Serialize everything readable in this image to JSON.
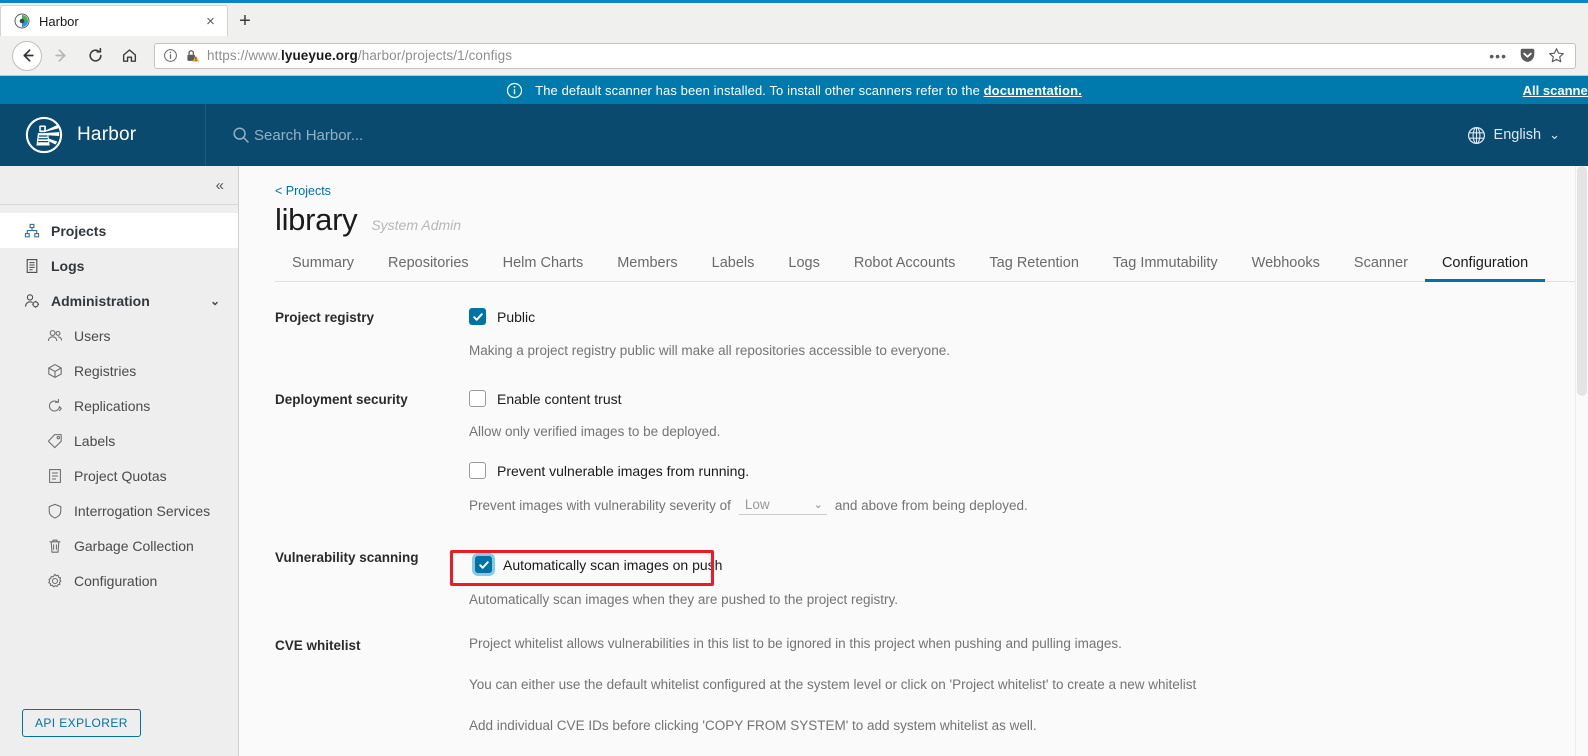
{
  "browser": {
    "tab": {
      "title": "Harbor",
      "favicon": "harbor-favicon",
      "close_label": "×"
    },
    "new_tab_label": "+",
    "nav": {
      "back": "←",
      "forward": "→",
      "reload": "⟳",
      "home": "⌂"
    },
    "url": {
      "scheme": "https://www.",
      "domain": "lyueyue.org",
      "path": "/harbor/projects/1/configs",
      "info_icon": "info-circle-icon",
      "lock_icon": "lock-warning-icon"
    },
    "url_actions": {
      "more": "•••",
      "pocket": "pocket-icon",
      "bookmark": "star-icon"
    }
  },
  "banner": {
    "icon": "info-circle-icon",
    "text_before": "The default scanner has been installed. To install other scanners refer to the ",
    "link": "documentation.",
    "right_link": "All scanners"
  },
  "header": {
    "brand": "Harbor",
    "logo": "harbor-lighthouse-logo",
    "search_placeholder": "Search Harbor...",
    "search_icon": "search-icon",
    "language": "English",
    "language_icon": "globe-icon",
    "language_chevron": "⌄"
  },
  "sidebar": {
    "collapse_icon": "«",
    "items": [
      {
        "label": "Projects",
        "icon": "projects-icon",
        "active": true,
        "sub": false
      },
      {
        "label": "Logs",
        "icon": "logs-icon",
        "active": false,
        "sub": false
      },
      {
        "label": "Administration",
        "icon": "administration-icon",
        "active": false,
        "sub": false,
        "chevron": "⌄"
      },
      {
        "label": "Users",
        "icon": "users-icon",
        "active": false,
        "sub": true
      },
      {
        "label": "Registries",
        "icon": "registries-icon",
        "active": false,
        "sub": true
      },
      {
        "label": "Replications",
        "icon": "replications-icon",
        "active": false,
        "sub": true
      },
      {
        "label": "Labels",
        "icon": "labels-icon",
        "active": false,
        "sub": true
      },
      {
        "label": "Project Quotas",
        "icon": "project-quotas-icon",
        "active": false,
        "sub": true
      },
      {
        "label": "Interrogation Services",
        "icon": "interrogation-services-icon",
        "active": false,
        "sub": true
      },
      {
        "label": "Garbage Collection",
        "icon": "garbage-collection-icon",
        "active": false,
        "sub": true
      },
      {
        "label": "Configuration",
        "icon": "configuration-icon",
        "active": false,
        "sub": true
      }
    ],
    "api_explorer": "API EXPLORER"
  },
  "main": {
    "breadcrumb": "< Projects",
    "project_name": "library",
    "project_role": "System Admin",
    "tabs": [
      {
        "label": "Summary",
        "active": false
      },
      {
        "label": "Repositories",
        "active": false
      },
      {
        "label": "Helm Charts",
        "active": false
      },
      {
        "label": "Members",
        "active": false
      },
      {
        "label": "Labels",
        "active": false
      },
      {
        "label": "Logs",
        "active": false
      },
      {
        "label": "Robot Accounts",
        "active": false
      },
      {
        "label": "Tag Retention",
        "active": false
      },
      {
        "label": "Tag Immutability",
        "active": false
      },
      {
        "label": "Webhooks",
        "active": false
      },
      {
        "label": "Scanner",
        "active": false
      },
      {
        "label": "Configuration",
        "active": true
      }
    ],
    "sections": {
      "project_registry": {
        "label": "Project registry",
        "checkbox_label": "Public",
        "checked": true,
        "help": "Making a project registry public will make all repositories accessible to everyone."
      },
      "deployment_security": {
        "label": "Deployment security",
        "content_trust_label": "Enable content trust",
        "content_trust_checked": false,
        "content_trust_help": "Allow only verified images to be deployed.",
        "prevent_label": "Prevent vulnerable images from running.",
        "prevent_checked": false,
        "severity_prefix": "Prevent images with vulnerability severity of",
        "severity_value": "Low",
        "severity_suffix": "and above from being deployed."
      },
      "vulnerability_scanning": {
        "label": "Vulnerability scanning",
        "checkbox_label": "Automatically scan images on push",
        "checked": true,
        "highlighted": true,
        "help": "Automatically scan images when they are pushed to the project registry."
      },
      "cve_whitelist": {
        "label": "CVE whitelist",
        "line1": "Project whitelist allows vulnerabilities in this list to be ignored in this project when pushing and pulling images.",
        "line2": "You can either use the default whitelist configured at the system level or click on 'Project whitelist' to create a new whitelist",
        "line3": "Add individual CVE IDs before clicking 'COPY FROM SYSTEM' to add system whitelist as well."
      }
    }
  },
  "colors": {
    "harbor_header": "#0b4a6f",
    "banner": "#0079ad",
    "accent": "#0072a3",
    "highlight": "#ee1b24"
  }
}
